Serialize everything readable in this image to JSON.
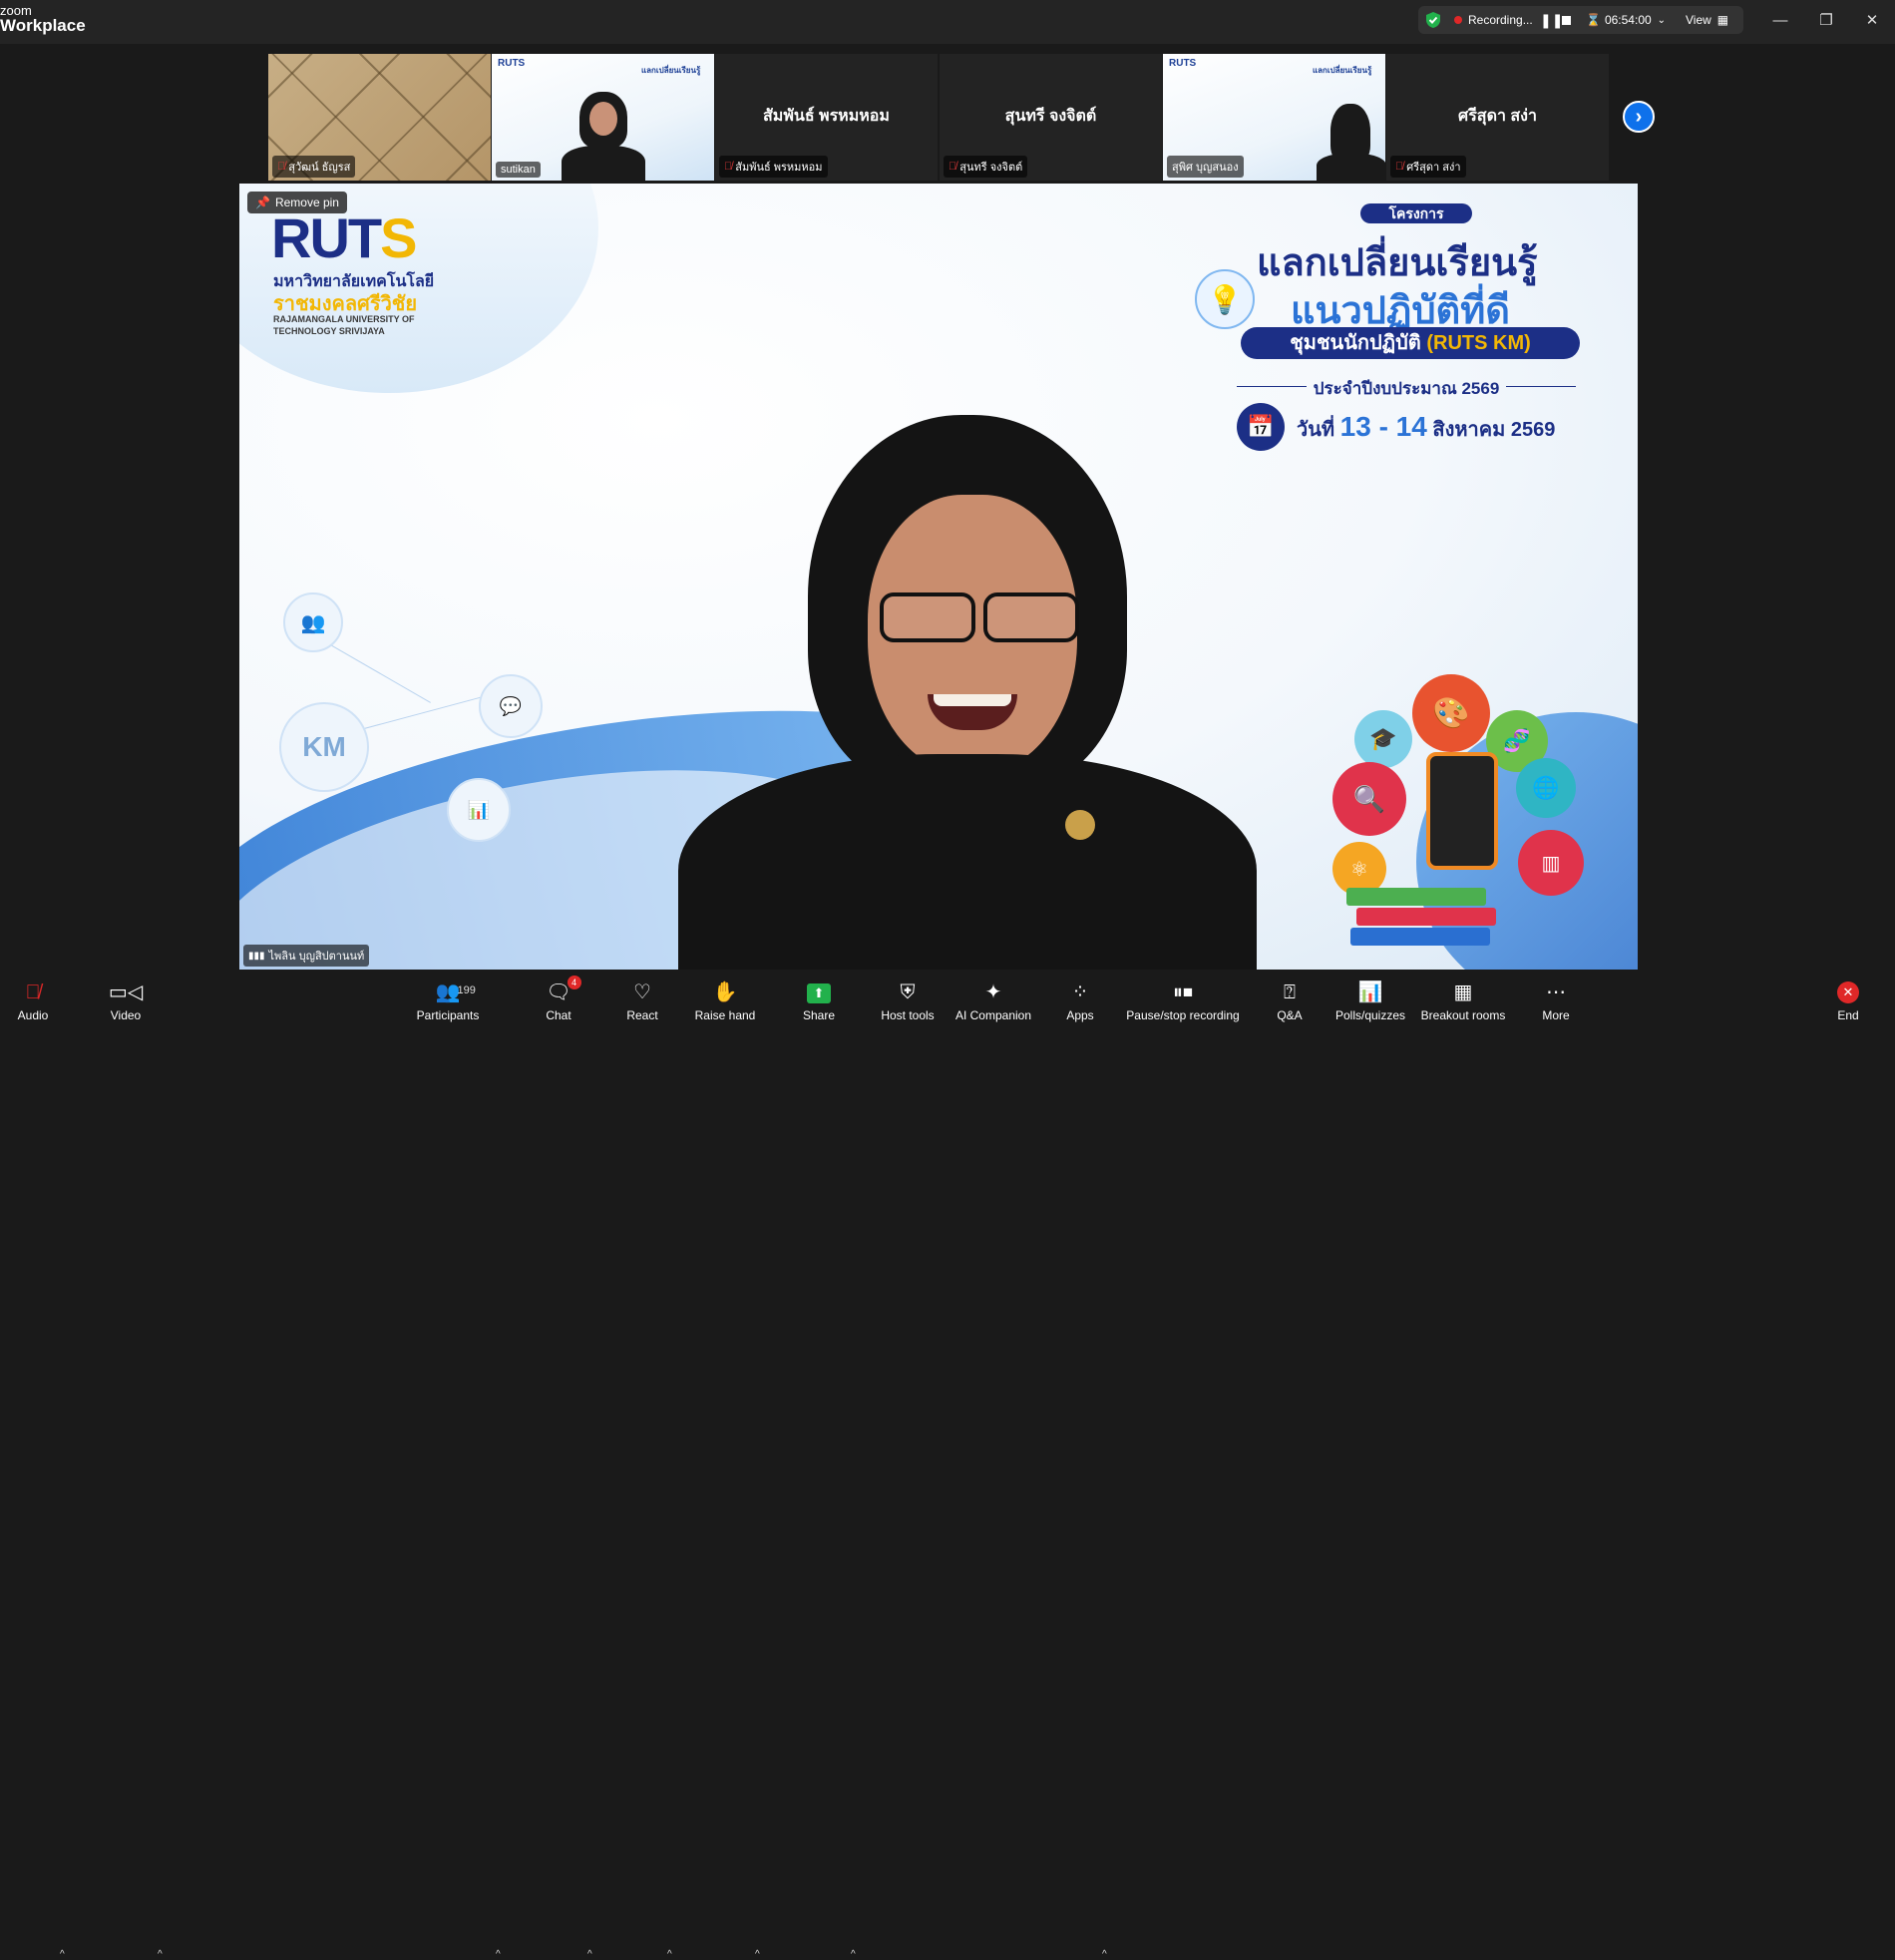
{
  "app": {
    "brand_line1": "zoom",
    "brand_line2": "Workplace"
  },
  "titlebar": {
    "recording_label": "Recording...",
    "timer": "06:54:00",
    "view_label": "View"
  },
  "participants_strip": [
    {
      "name_label": "สุวัฒน์ ธัญรส",
      "muted": true,
      "video": "leather"
    },
    {
      "name_label": "sutikan",
      "muted": false,
      "video": "slide-person"
    },
    {
      "name_big": "สัมพันธ์ พรหมหอม",
      "name_label": "สัมพันธ์ พรหมหอม",
      "muted": true
    },
    {
      "name_big": "สุนทรี จงจิตต์",
      "name_label": "สุนทรี จงจิตต์",
      "muted": true
    },
    {
      "name_label": "สุพิศ บุญสนอง",
      "muted": false,
      "video": "slide-person"
    },
    {
      "name_big": "ศรีสุดา สง่า",
      "name_label": "ศรีสุดา สง่า",
      "muted": true
    }
  ],
  "main_video": {
    "remove_pin_label": "Remove pin",
    "speaker_label": "ไพลิน บุญสิปตานนท์",
    "slide": {
      "logo_text_a": "RUT",
      "logo_text_b": "S",
      "logo_th_line1": "มหาวิทยาลัยเทคโนโลยี",
      "logo_th_line2": "ราชมงคลศรีวิชัย",
      "logo_en": "RAJAMANGALA UNIVERSITY OF TECHNOLOGY SRIVIJAYA",
      "project_tag": "โครงการ",
      "title_line1": "แลกเปลี่ยนเรียนรู้",
      "title_line2": "แนวปฏิบัติที่ดี",
      "banner_a": "ชุมชนนักปฏิบัติ",
      "banner_b": "(RUTS KM)",
      "fiscal_year": "ประจำปีงบประมาณ 2569",
      "date_prefix": "วันที่",
      "date_range": "13 - 14",
      "date_suffix": "สิงหาคม 2569",
      "km_label": "KM"
    }
  },
  "toolbar": {
    "audio": "Audio",
    "video": "Video",
    "participants": "Participants",
    "participants_count": "199",
    "chat": "Chat",
    "chat_badge": "4",
    "react": "React",
    "raise_hand": "Raise hand",
    "share": "Share",
    "host_tools": "Host tools",
    "ai_companion": "AI Companion",
    "apps": "Apps",
    "pause_stop_recording": "Pause/stop recording",
    "qa": "Q&A",
    "polls": "Polls/quizzes",
    "breakout": "Breakout rooms",
    "more": "More",
    "end": "End"
  }
}
